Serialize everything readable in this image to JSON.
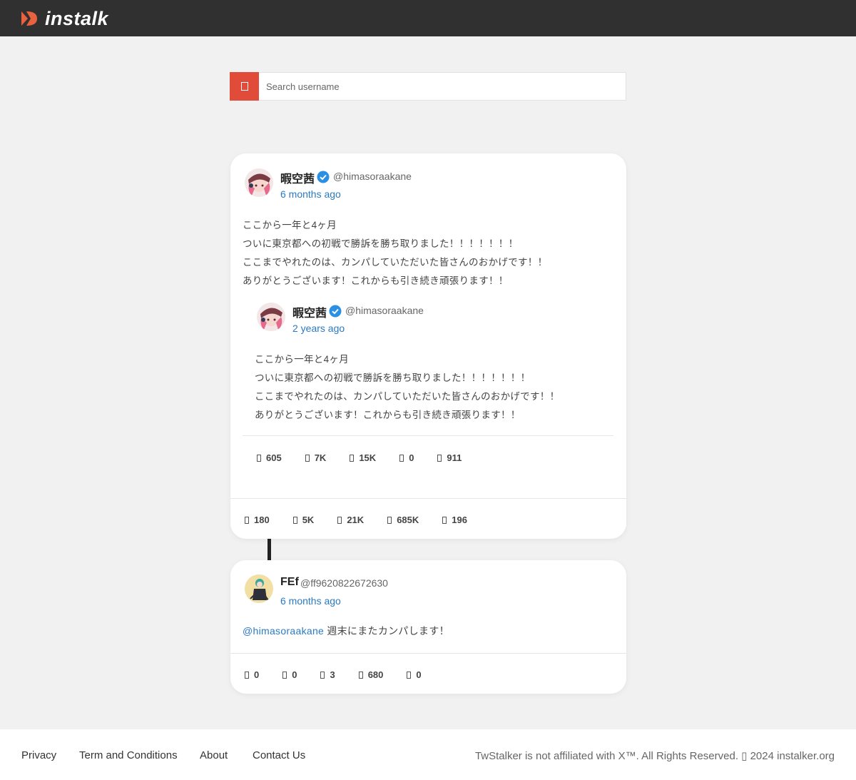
{
  "header": {
    "logo_text": "instalk"
  },
  "search": {
    "placeholder": "Search username",
    "button_icon": "search-icon"
  },
  "tweet1": {
    "name": "暇空茜",
    "handle": "@himasoraakane",
    "time": "6 months ago",
    "lines": [
      "ここから一年と4ヶ月",
      "ついに東京都への初戦で勝訴を勝ち取りました！！！！！！！",
      "ここまでやれたのは、カンパしていただいた皆さんのおかげです！！",
      "ありがとうございます！これからも引き続き頑張ります！！"
    ],
    "quote": {
      "name": "暇空茜",
      "handle": "@himasoraakane",
      "time": "2 years ago",
      "lines": [
        "ここから一年と4ヶ月",
        "ついに東京都への初戦で勝訴を勝ち取りました！！！！！！！",
        "ここまでやれたのは、カンパしていただいた皆さんのおかげです！！",
        "ありがとうございます！これからも引き続き頑張ります！！"
      ],
      "stats": [
        "605",
        "7K",
        "15K",
        "0",
        "911"
      ]
    },
    "stats": [
      "180",
      "5K",
      "21K",
      "685K",
      "196"
    ]
  },
  "tweet2": {
    "name": "FEf",
    "handle": "@ff9620822672630",
    "time": "6 months ago",
    "mention": "@himasoraakane",
    "text": " 週末にまたカンパします！",
    "stats": [
      "0",
      "0",
      "3",
      "680",
      "0"
    ]
  },
  "footer": {
    "links": [
      "Privacy",
      "Term and Conditions",
      "About",
      "Contact Us"
    ],
    "copyright": "TwStalker is not affiliated with X™. All Rights Reserved. ▯ 2024 instalker.org"
  },
  "colors": {
    "brand": "#e04b3a",
    "link": "#2a7ac4",
    "topbar": "#303030"
  }
}
